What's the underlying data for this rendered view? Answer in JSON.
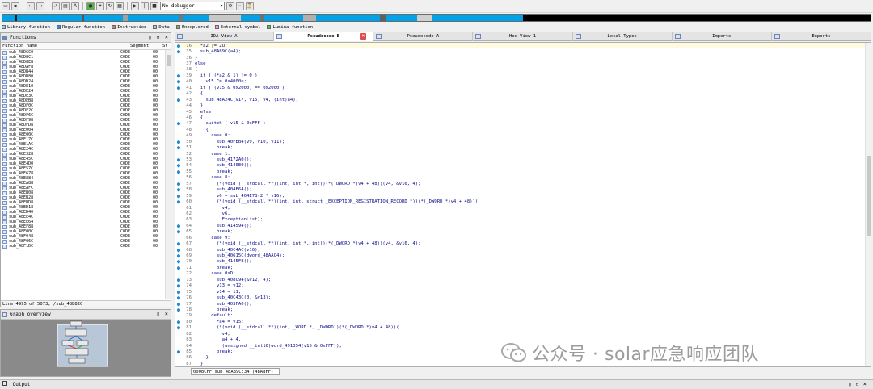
{
  "toolbar": {
    "debugger_select": "No debugger"
  },
  "navband": {
    "colors": [
      "#00a2e8",
      "#000000",
      "#8c8c8c",
      "#00a2e8",
      "#6a6a6a",
      "#00a2e8",
      "#d8d8d8",
      "#00a2e8",
      "#000000",
      "#00a2e8",
      "#000000"
    ],
    "widths": [
      8,
      3,
      6,
      14,
      3,
      26,
      4,
      22,
      2,
      12,
      0
    ]
  },
  "legend": {
    "items": [
      {
        "label": "Library function",
        "color": "#7fd7ff"
      },
      {
        "label": "Regular function",
        "color": "#1e90ff"
      },
      {
        "label": "Instruction",
        "color": "#c08080"
      },
      {
        "label": "Data",
        "color": "#c0c0c0"
      },
      {
        "label": "Unexplored",
        "color": "#a8a060"
      },
      {
        "label": "External symbol",
        "color": "#ff8cff"
      },
      {
        "label": "Lumina function",
        "color": "#40d040"
      }
    ]
  },
  "functions_panel": {
    "title": "Functions",
    "col_name": "Function name",
    "col_segment": "Segment",
    "col_start": "St",
    "rows": [
      {
        "name": "sub_48D6C0",
        "seg": "CODE",
        "st": "00"
      },
      {
        "name": "sub_48D8C1",
        "seg": "CODE",
        "st": "00"
      },
      {
        "name": "sub_48D8E8",
        "seg": "CODE",
        "st": "00"
      },
      {
        "name": "sub_48DAF8",
        "seg": "CODE",
        "st": "00"
      },
      {
        "name": "sub_48DB44",
        "seg": "CODE",
        "st": "00"
      },
      {
        "name": "sub_48DB80",
        "seg": "CODE",
        "st": "00"
      },
      {
        "name": "sub_48DD24",
        "seg": "CODE",
        "st": "00"
      },
      {
        "name": "sub_48DE10",
        "seg": "CODE",
        "st": "00"
      },
      {
        "name": "sub_48DE24",
        "seg": "CODE",
        "st": "00"
      },
      {
        "name": "sub_48DE3C",
        "seg": "CODE",
        "st": "00"
      },
      {
        "name": "sub_48DEB8",
        "seg": "CODE",
        "st": "00"
      },
      {
        "name": "sub_48DF0C",
        "seg": "CODE",
        "st": "00"
      },
      {
        "name": "sub_48DF2C",
        "seg": "CODE",
        "st": "00"
      },
      {
        "name": "sub_48DF6C",
        "seg": "CODE",
        "st": "00"
      },
      {
        "name": "sub_48DF98",
        "seg": "CODE",
        "st": "00"
      },
      {
        "name": "sub_48DFD8",
        "seg": "CODE",
        "st": "00"
      },
      {
        "name": "sub_48E004",
        "seg": "CODE",
        "st": "00"
      },
      {
        "name": "sub_48E00C",
        "seg": "CODE",
        "st": "00"
      },
      {
        "name": "sub_48E17C",
        "seg": "CODE",
        "st": "00"
      },
      {
        "name": "sub_48E1AC",
        "seg": "CODE",
        "st": "00"
      },
      {
        "name": "sub_48E24C",
        "seg": "CODE",
        "st": "00"
      },
      {
        "name": "sub_48E328",
        "seg": "CODE",
        "st": "00"
      },
      {
        "name": "sub_48E45C",
        "seg": "CODE",
        "st": "00"
      },
      {
        "name": "sub_48E4D0",
        "seg": "CODE",
        "st": "00"
      },
      {
        "name": "sub_48E57C",
        "seg": "CODE",
        "st": "00"
      },
      {
        "name": "sub_48E678",
        "seg": "CODE",
        "st": "00"
      },
      {
        "name": "sub_48E884",
        "seg": "CODE",
        "st": "00"
      },
      {
        "name": "sub_48EA88",
        "seg": "CODE",
        "st": "00"
      },
      {
        "name": "sub_48EAFC",
        "seg": "CODE",
        "st": "00"
      },
      {
        "name": "sub_48EB08",
        "seg": "CODE",
        "st": "00"
      },
      {
        "name": "sub_48EB28",
        "seg": "CODE",
        "st": "00"
      },
      {
        "name": "sub_48EBD8",
        "seg": "CODE",
        "st": "00"
      },
      {
        "name": "sub_48ED18",
        "seg": "CODE",
        "st": "00"
      },
      {
        "name": "sub_48ED40",
        "seg": "CODE",
        "st": "00"
      },
      {
        "name": "sub_48EE4C",
        "seg": "CODE",
        "st": "00"
      },
      {
        "name": "sub_48EE64",
        "seg": "CODE",
        "st": "00"
      },
      {
        "name": "sub_48EF88",
        "seg": "CODE",
        "st": "00"
      },
      {
        "name": "sub_48F00C",
        "seg": "CODE",
        "st": "00"
      },
      {
        "name": "sub_48F048",
        "seg": "CODE",
        "st": "00"
      },
      {
        "name": "sub_48F06C",
        "seg": "CODE",
        "st": "00"
      },
      {
        "name": "sub_48F1DC",
        "seg": "CODE",
        "st": "00"
      }
    ],
    "status": "Line 4995 of 5073, /sub_48B820"
  },
  "graph_panel": {
    "title": "Graph overview"
  },
  "tabs": [
    {
      "label": "IDA View-A",
      "active": false,
      "closable": false
    },
    {
      "label": "Pseudocode-B",
      "active": true,
      "closable": true
    },
    {
      "label": "Pseudocode-A",
      "active": false,
      "closable": false
    },
    {
      "label": "Hex View-1",
      "active": false,
      "closable": false
    },
    {
      "label": "Local Types",
      "active": false,
      "closable": false
    },
    {
      "label": "Imports",
      "active": false,
      "closable": false
    },
    {
      "label": "Exports",
      "active": false,
      "closable": false
    }
  ],
  "code": [
    {
      "n": "16",
      "dot": true,
      "t": "  *a2 |= 2u;"
    },
    {
      "n": "35",
      "dot": true,
      "t": "  sub_48A89C(a4);"
    },
    {
      "n": "36",
      "dot": false,
      "t": "}"
    },
    {
      "n": "37",
      "dot": false,
      "t": "else"
    },
    {
      "n": "38",
      "dot": false,
      "t": "{"
    },
    {
      "n": "39",
      "dot": true,
      "t": "  if ( (*a2 & 1) != 0 )"
    },
    {
      "n": "40",
      "dot": true,
      "t": "    v15 ^= 0x4000u;"
    },
    {
      "n": "41",
      "dot": true,
      "t": "  if ( (v15 & 0x2000) == 0x2000 )"
    },
    {
      "n": "42",
      "dot": false,
      "t": "  {"
    },
    {
      "n": "43",
      "dot": true,
      "t": "    sub_48A24C(v17, v15, v4, (int)a4);"
    },
    {
      "n": "44",
      "dot": false,
      "t": "  }"
    },
    {
      "n": "45",
      "dot": false,
      "t": "  else"
    },
    {
      "n": "46",
      "dot": false,
      "t": "  {"
    },
    {
      "n": "47",
      "dot": true,
      "t": "    switch ( v15 & 0xFFF )"
    },
    {
      "n": "48",
      "dot": false,
      "t": "    {"
    },
    {
      "n": "49",
      "dot": false,
      "t": "      case 0:"
    },
    {
      "n": "50",
      "dot": true,
      "t": "        sub_40FEB4(v9, v10, v11);"
    },
    {
      "n": "51",
      "dot": true,
      "t": "        break;"
    },
    {
      "n": "52",
      "dot": false,
      "t": "      case 1:"
    },
    {
      "n": "53",
      "dot": true,
      "t": "        sub_4172A0();"
    },
    {
      "n": "54",
      "dot": true,
      "t": "        sub_4146E0();"
    },
    {
      "n": "55",
      "dot": true,
      "t": "        break;"
    },
    {
      "n": "56",
      "dot": false,
      "t": "      case 8:"
    },
    {
      "n": "57",
      "dot": true,
      "t": "        (*(void (__stdcall **)(int, int *, int))(*(_DWORD *)v4 + 48))(v4, &v16, 4);"
    },
    {
      "n": "58",
      "dot": true,
      "t": "        sub_404F64();"
    },
    {
      "n": "59",
      "dot": true,
      "t": "        v6 = sub_404E78(2 * v16);"
    },
    {
      "n": "60",
      "dot": true,
      "t": "        (*(void (__stdcall **)(int, int, struct _EXCEPTION_REGISTRATION_RECORD *))(*(_DWORD *)v4 + 48))("
    },
    {
      "n": "61",
      "dot": false,
      "t": "          v4,"
    },
    {
      "n": "62",
      "dot": false,
      "t": "          v6,"
    },
    {
      "n": "63",
      "dot": false,
      "t": "          ExceptionList);"
    },
    {
      "n": "64",
      "dot": true,
      "t": "        sub_414594();"
    },
    {
      "n": "65",
      "dot": true,
      "t": "        break;"
    },
    {
      "n": "66",
      "dot": false,
      "t": "      case 9:"
    },
    {
      "n": "67",
      "dot": true,
      "t": "        (*(void (__stdcall **)(int, int *, int))(*(_DWORD *)v4 + 48))(v4, &v16, 4);"
    },
    {
      "n": "68",
      "dot": true,
      "t": "        sub_40C4AC(v16);"
    },
    {
      "n": "69",
      "dot": true,
      "t": "        sub_40615C(dword_48AAC4);"
    },
    {
      "n": "70",
      "dot": true,
      "t": "        sub_4145F8();"
    },
    {
      "n": "71",
      "dot": true,
      "t": "        break;"
    },
    {
      "n": "72",
      "dot": false,
      "t": "      case 0xD:"
    },
    {
      "n": "73",
      "dot": true,
      "t": "        sub_408C94(&v12, 4);"
    },
    {
      "n": "74",
      "dot": true,
      "t": "        v13 = v12;"
    },
    {
      "n": "75",
      "dot": true,
      "t": "        v14 = 11;"
    },
    {
      "n": "76",
      "dot": true,
      "t": "        sub_40C43C(0, &v13);"
    },
    {
      "n": "77",
      "dot": true,
      "t": "        sub_403FA0();"
    },
    {
      "n": "78",
      "dot": true,
      "t": "        break;"
    },
    {
      "n": "79",
      "dot": false,
      "t": "      default:"
    },
    {
      "n": "80",
      "dot": true,
      "t": "        *a4 = v15;"
    },
    {
      "n": "81",
      "dot": true,
      "t": "        (*(void (__stdcall **)(int, _WORD *, _DWORD))(*(_DWORD *)v4 + 48))("
    },
    {
      "n": "82",
      "dot": false,
      "t": "          v4,"
    },
    {
      "n": "83",
      "dot": false,
      "t": "          a4 + 4,"
    },
    {
      "n": "84",
      "dot": false,
      "t": "          (unsigned __int16)word_491354[v15 & 0xFFF]);"
    },
    {
      "n": "85",
      "dot": true,
      "t": "        break;"
    },
    {
      "n": "86",
      "dot": false,
      "t": "    }"
    },
    {
      "n": "87",
      "dot": false,
      "t": "  }"
    }
  ],
  "code_status": "0008CFF sub_48A89C:34 (48A8FF)",
  "watermark": "公众号 · solar应急响应团队",
  "output": {
    "title": "Output"
  }
}
